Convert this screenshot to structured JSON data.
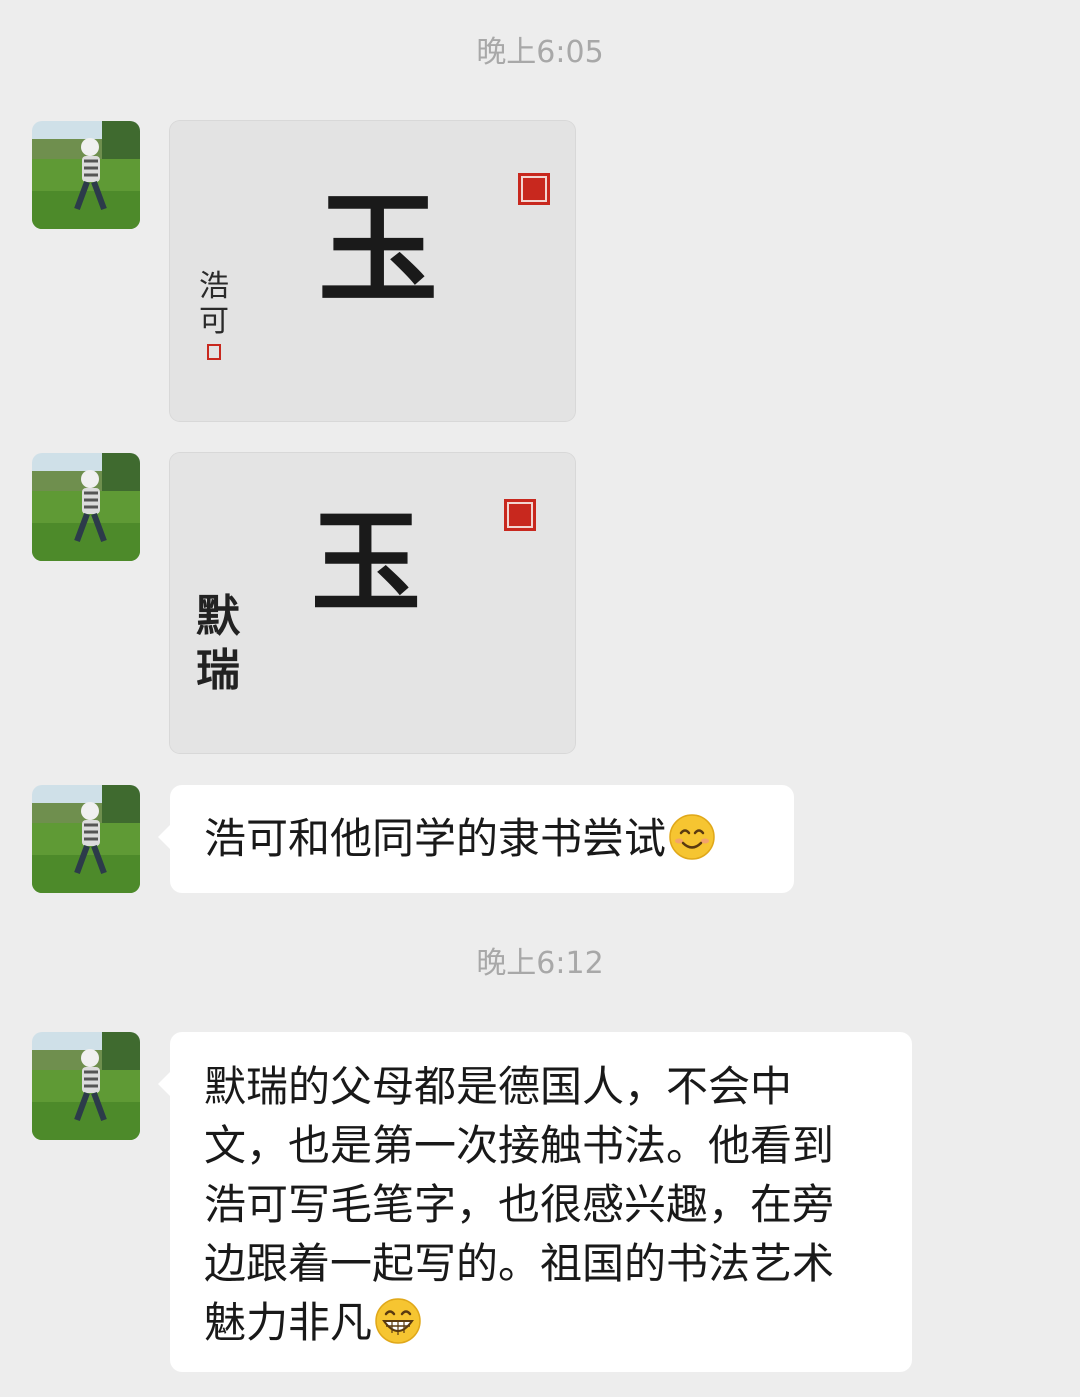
{
  "chat": {
    "timestamps": [
      "晚上6:05",
      "晚上6:12"
    ],
    "image_1": {
      "main_char": "玉",
      "signature_lines": [
        "浩",
        "可"
      ]
    },
    "image_2": {
      "main_char": "玉",
      "signature_lines": [
        "默",
        "瑞"
      ]
    },
    "message_1": {
      "text": "浩可和他同学的隶书尝试",
      "emoji": "smiling-face-emoji"
    },
    "message_2": {
      "lines": [
        "默瑞的父母都是德国人，不会中",
        "文，也是第一次接触书法。他看到",
        "浩可写毛笔字，也很感兴趣，在旁",
        "边跟着一起写的。祖国的书法艺术",
        "魅力非凡"
      ],
      "emoji": "grinning-face-emoji"
    }
  },
  "colors": {
    "background": "#ededed",
    "bubble": "#ffffff",
    "timestamp_text": "#a8a8a8",
    "message_text": "#191919",
    "seal_red": "#c8281e"
  }
}
